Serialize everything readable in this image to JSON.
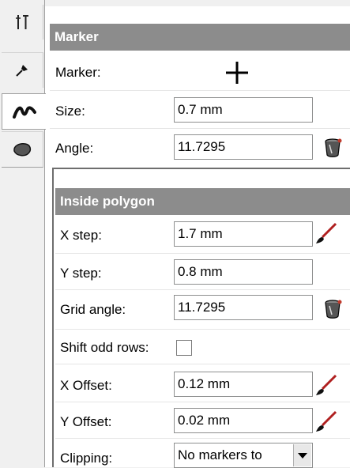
{
  "marker_section": {
    "title": "Marker",
    "marker_label": "Marker:",
    "marker_symbol": "+",
    "size_label": "Size:",
    "size_value": "0.7 mm",
    "angle_label": "Angle:",
    "angle_value": "11.7295"
  },
  "inside_polygon": {
    "title": "Inside polygon",
    "x_step_label": "X step:",
    "x_step_value": "1.7 mm",
    "y_step_label": "Y step:",
    "y_step_value": "0.8 mm",
    "grid_angle_label": "Grid angle:",
    "grid_angle_value": "11.7295",
    "shift_odd_rows_label": "Shift odd rows:",
    "shift_odd_rows_checked": false,
    "x_offset_label": "X Offset:",
    "x_offset_value": "0.12 mm",
    "y_offset_label": "Y Offset:",
    "y_offset_value": "0.02 mm",
    "clipping_label": "Clipping:",
    "clipping_value": "No markers to"
  },
  "tabs": [
    {
      "icon": "tools-icon"
    },
    {
      "icon": "pin-icon"
    },
    {
      "icon": "stroke-icon",
      "active": true
    },
    {
      "icon": "blob-icon"
    }
  ],
  "colors": {
    "header_bg": "#8c8c8c",
    "panel_bg": "#ffffff",
    "field_border": "#8e8f8f"
  }
}
